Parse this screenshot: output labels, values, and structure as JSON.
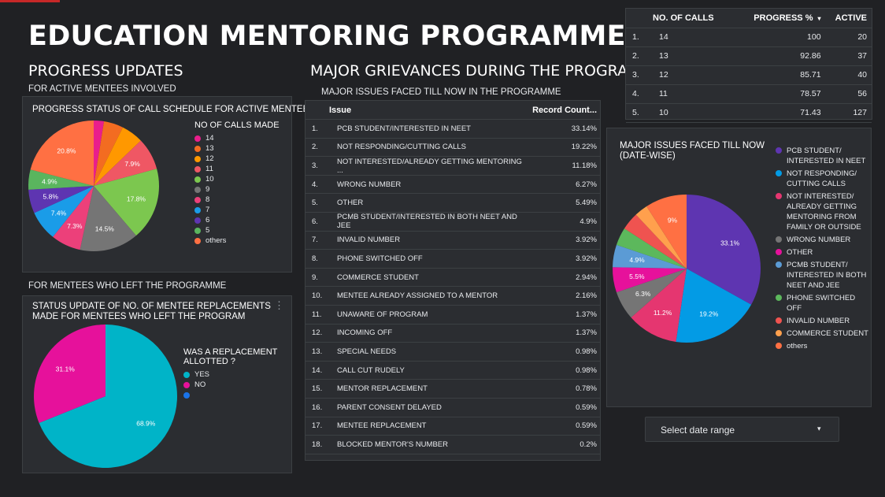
{
  "header": {
    "title": "EDUCATION MENTORING PROGRAMME"
  },
  "progress": {
    "heading": "PROGRESS UPDATES",
    "subheading": "FOR ACTIVE MENTEES INVOLVED",
    "card_title": "PROGRESS  STATUS OF  CALL SCHEDULE FOR  ACTIVE MENTEES",
    "legend_title": "NO OF CALLS MADE",
    "legend": [
      {
        "label": "14",
        "color": "#e91e8c"
      },
      {
        "label": "13",
        "color": "#f36c21"
      },
      {
        "label": "12",
        "color": "#ff9800"
      },
      {
        "label": "11",
        "color": "#ef5764"
      },
      {
        "label": "10",
        "color": "#7cc74f"
      },
      {
        "label": "9",
        "color": "#757575"
      },
      {
        "label": "8",
        "color": "#ec407a"
      },
      {
        "label": "7",
        "color": "#1a9ce8"
      },
      {
        "label": "6",
        "color": "#5e35b1"
      },
      {
        "label": "5",
        "color": "#5ab55e"
      },
      {
        "label": "others",
        "color": "#ff7043"
      }
    ],
    "slice_labels": [
      "20.8%",
      "7.9%",
      "17.8%",
      "14.5%",
      "7.3%",
      "7.4%",
      "5.8%",
      "4.9%"
    ]
  },
  "left_program": {
    "heading": "FOR  MENTEES WHO LEFT THE PROGRAMME",
    "card_title_line1": "STATUS UPDATE OF NO. OF MENTEE REPLACEMENTS",
    "card_title_line2": "MADE FOR MENTEES WHO LEFT THE PROGRAM",
    "legend_title_line1": "WAS A REPLACEMENT",
    "legend_title_line2": "ALLOTTED ?",
    "legend": [
      {
        "label": "YES",
        "color": "#00b4c8"
      },
      {
        "label": "NO",
        "color": "#e6119b"
      },
      {
        "label": "",
        "color": "#1a73e8"
      }
    ],
    "slice_labels": [
      "31.1%",
      "68.9%"
    ]
  },
  "grievances": {
    "heading": "MAJOR GRIEVANCES DURING THE PROGRAM",
    "subheading": "MAJOR ISSUES FACED TILL NOW  IN THE PROGRAMME",
    "columns": [
      "Issue",
      "Record Count..."
    ],
    "rows": [
      {
        "idx": "1.",
        "issue": "PCB STUDENT/INTERESTED IN NEET",
        "value": "33.14%"
      },
      {
        "idx": "2.",
        "issue": "NOT RESPONDING/CUTTING CALLS",
        "value": "19.22%"
      },
      {
        "idx": "3.",
        "issue": "NOT INTERESTED/ALREADY GETTING MENTORING ...",
        "value": "11.18%"
      },
      {
        "idx": "4.",
        "issue": "WRONG NUMBER",
        "value": "6.27%"
      },
      {
        "idx": "5.",
        "issue": "OTHER",
        "value": "5.49%"
      },
      {
        "idx": "6.",
        "issue": "PCMB STUDENT/INTERESTED IN BOTH NEET AND JEE",
        "value": "4.9%"
      },
      {
        "idx": "7.",
        "issue": "INVALID NUMBER",
        "value": "3.92%"
      },
      {
        "idx": "8.",
        "issue": "PHONE SWITCHED OFF",
        "value": "3.92%"
      },
      {
        "idx": "9.",
        "issue": "COMMERCE STUDENT",
        "value": "2.94%"
      },
      {
        "idx": "10.",
        "issue": "MENTEE ALREADY ASSIGNED TO A MENTOR",
        "value": "2.16%"
      },
      {
        "idx": "11.",
        "issue": "UNAWARE OF PROGRAM",
        "value": "1.37%"
      },
      {
        "idx": "12.",
        "issue": "INCOMING OFF",
        "value": "1.37%"
      },
      {
        "idx": "13.",
        "issue": "SPECIAL NEEDS",
        "value": "0.98%"
      },
      {
        "idx": "14.",
        "issue": "CALL CUT RUDELY",
        "value": "0.98%"
      },
      {
        "idx": "15.",
        "issue": "MENTOR REPLACEMENT",
        "value": "0.78%"
      },
      {
        "idx": "16.",
        "issue": "PARENT CONSENT DELAYED",
        "value": "0.59%"
      },
      {
        "idx": "17.",
        "issue": "MENTEE REPLACEMENT",
        "value": "0.59%"
      },
      {
        "idx": "18.",
        "issue": "BLOCKED MENTOR'S NUMBER",
        "value": "0.2%"
      }
    ]
  },
  "calls_table": {
    "columns": [
      "NO. OF CALLS",
      "PROGRESS %",
      "ACTIVE"
    ],
    "sort_icon": "▾",
    "rows": [
      {
        "idx": "1.",
        "calls": "14",
        "progress": "100",
        "active": "20"
      },
      {
        "idx": "2.",
        "calls": "13",
        "progress": "92.86",
        "active": "37"
      },
      {
        "idx": "3.",
        "calls": "12",
        "progress": "85.71",
        "active": "40"
      },
      {
        "idx": "4.",
        "calls": "11",
        "progress": "78.57",
        "active": "56"
      },
      {
        "idx": "5.",
        "calls": "10",
        "progress": "71.43",
        "active": "127"
      }
    ]
  },
  "datewise": {
    "card_title_line1": "MAJOR ISSUES FACED TILL NOW",
    "card_title_line2": "(DATE-WISE)",
    "legend": [
      {
        "label": "PCB STUDENT/ INTERESTED IN NEET",
        "color": "#5e35b1"
      },
      {
        "label": "NOT RESPONDING/ CUTTING CALLS",
        "color": "#039be5"
      },
      {
        "label": "NOT INTERESTED/ ALREADY GETTING MENTORING FROM FAMILY OR OUTSIDE",
        "color": "#e53670"
      },
      {
        "label": "WRONG NUMBER",
        "color": "#757575"
      },
      {
        "label": "OTHER",
        "color": "#e6119b"
      },
      {
        "label": "PCMB STUDENT/ INTERESTED IN BOTH NEET AND JEE",
        "color": "#5b9bd5"
      },
      {
        "label": "PHONE SWITCHED OFF",
        "color": "#5cb85c"
      },
      {
        "label": "INVALID NUMBER",
        "color": "#ef5350"
      },
      {
        "label": "COMMERCE STUDENT",
        "color": "#ffa04d"
      },
      {
        "label": "others",
        "color": "#ff7043"
      }
    ],
    "slice_labels": [
      "33.1%",
      "19.2%",
      "11.2%",
      "6.3%",
      "5.5%",
      "4.9%",
      "9%"
    ]
  },
  "date_range": {
    "label": "Select date range",
    "dropdown_icon": "▾"
  }
}
